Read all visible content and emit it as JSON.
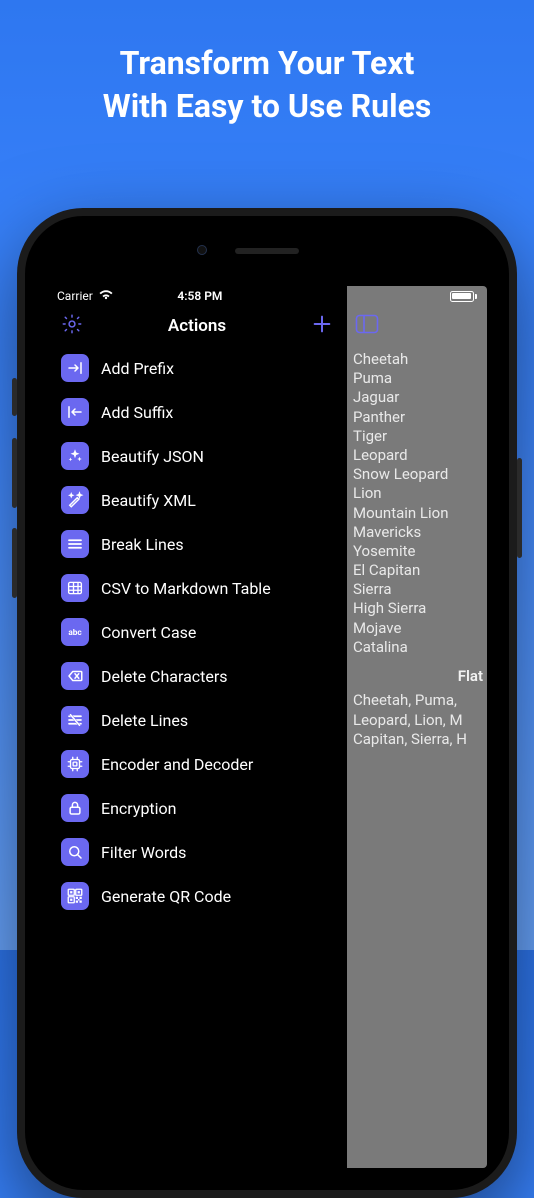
{
  "promo": {
    "line1": "Transform Your Text",
    "line2": "With Easy to Use Rules"
  },
  "statusBar": {
    "carrier": "Carrier",
    "time": "4:58 PM"
  },
  "nav": {
    "title": "Actions"
  },
  "actions": [
    {
      "id": "add-prefix",
      "label": "Add Prefix",
      "icon": "arrow-in-right"
    },
    {
      "id": "add-suffix",
      "label": "Add Suffix",
      "icon": "arrow-in-left"
    },
    {
      "id": "beautify-json",
      "label": "Beautify JSON",
      "icon": "sparkle"
    },
    {
      "id": "beautify-xml",
      "label": "Beautify XML",
      "icon": "wand"
    },
    {
      "id": "break-lines",
      "label": "Break Lines",
      "icon": "lines"
    },
    {
      "id": "csv-md",
      "label": "CSV to Markdown Table",
      "icon": "table"
    },
    {
      "id": "convert-case",
      "label": "Convert Case",
      "icon": "abc"
    },
    {
      "id": "delete-chars",
      "label": "Delete Characters",
      "icon": "delete-back"
    },
    {
      "id": "delete-lines",
      "label": "Delete Lines",
      "icon": "lines-strike"
    },
    {
      "id": "encoder-decoder",
      "label": "Encoder and Decoder",
      "icon": "chip"
    },
    {
      "id": "encryption",
      "label": "Encryption",
      "icon": "lock"
    },
    {
      "id": "filter-words",
      "label": "Filter Words",
      "icon": "search-doc"
    },
    {
      "id": "qr",
      "label": "Generate QR Code",
      "icon": "qr"
    }
  ],
  "preview": {
    "lines": [
      "Cheetah",
      "Puma",
      "Jaguar",
      "Panther",
      "Tiger",
      "Leopard",
      "Snow Leopard",
      "Lion",
      "Mountain Lion",
      "Mavericks",
      "Yosemite",
      "El Capitan",
      "Sierra",
      "High Sierra",
      "Mojave",
      "Catalina"
    ],
    "dividerLabel": "Flat",
    "wrapped": "Cheetah, Puma, Leopard, Lion, M Capitan, Sierra, H"
  },
  "colors": {
    "accent": "#6b68f0"
  }
}
